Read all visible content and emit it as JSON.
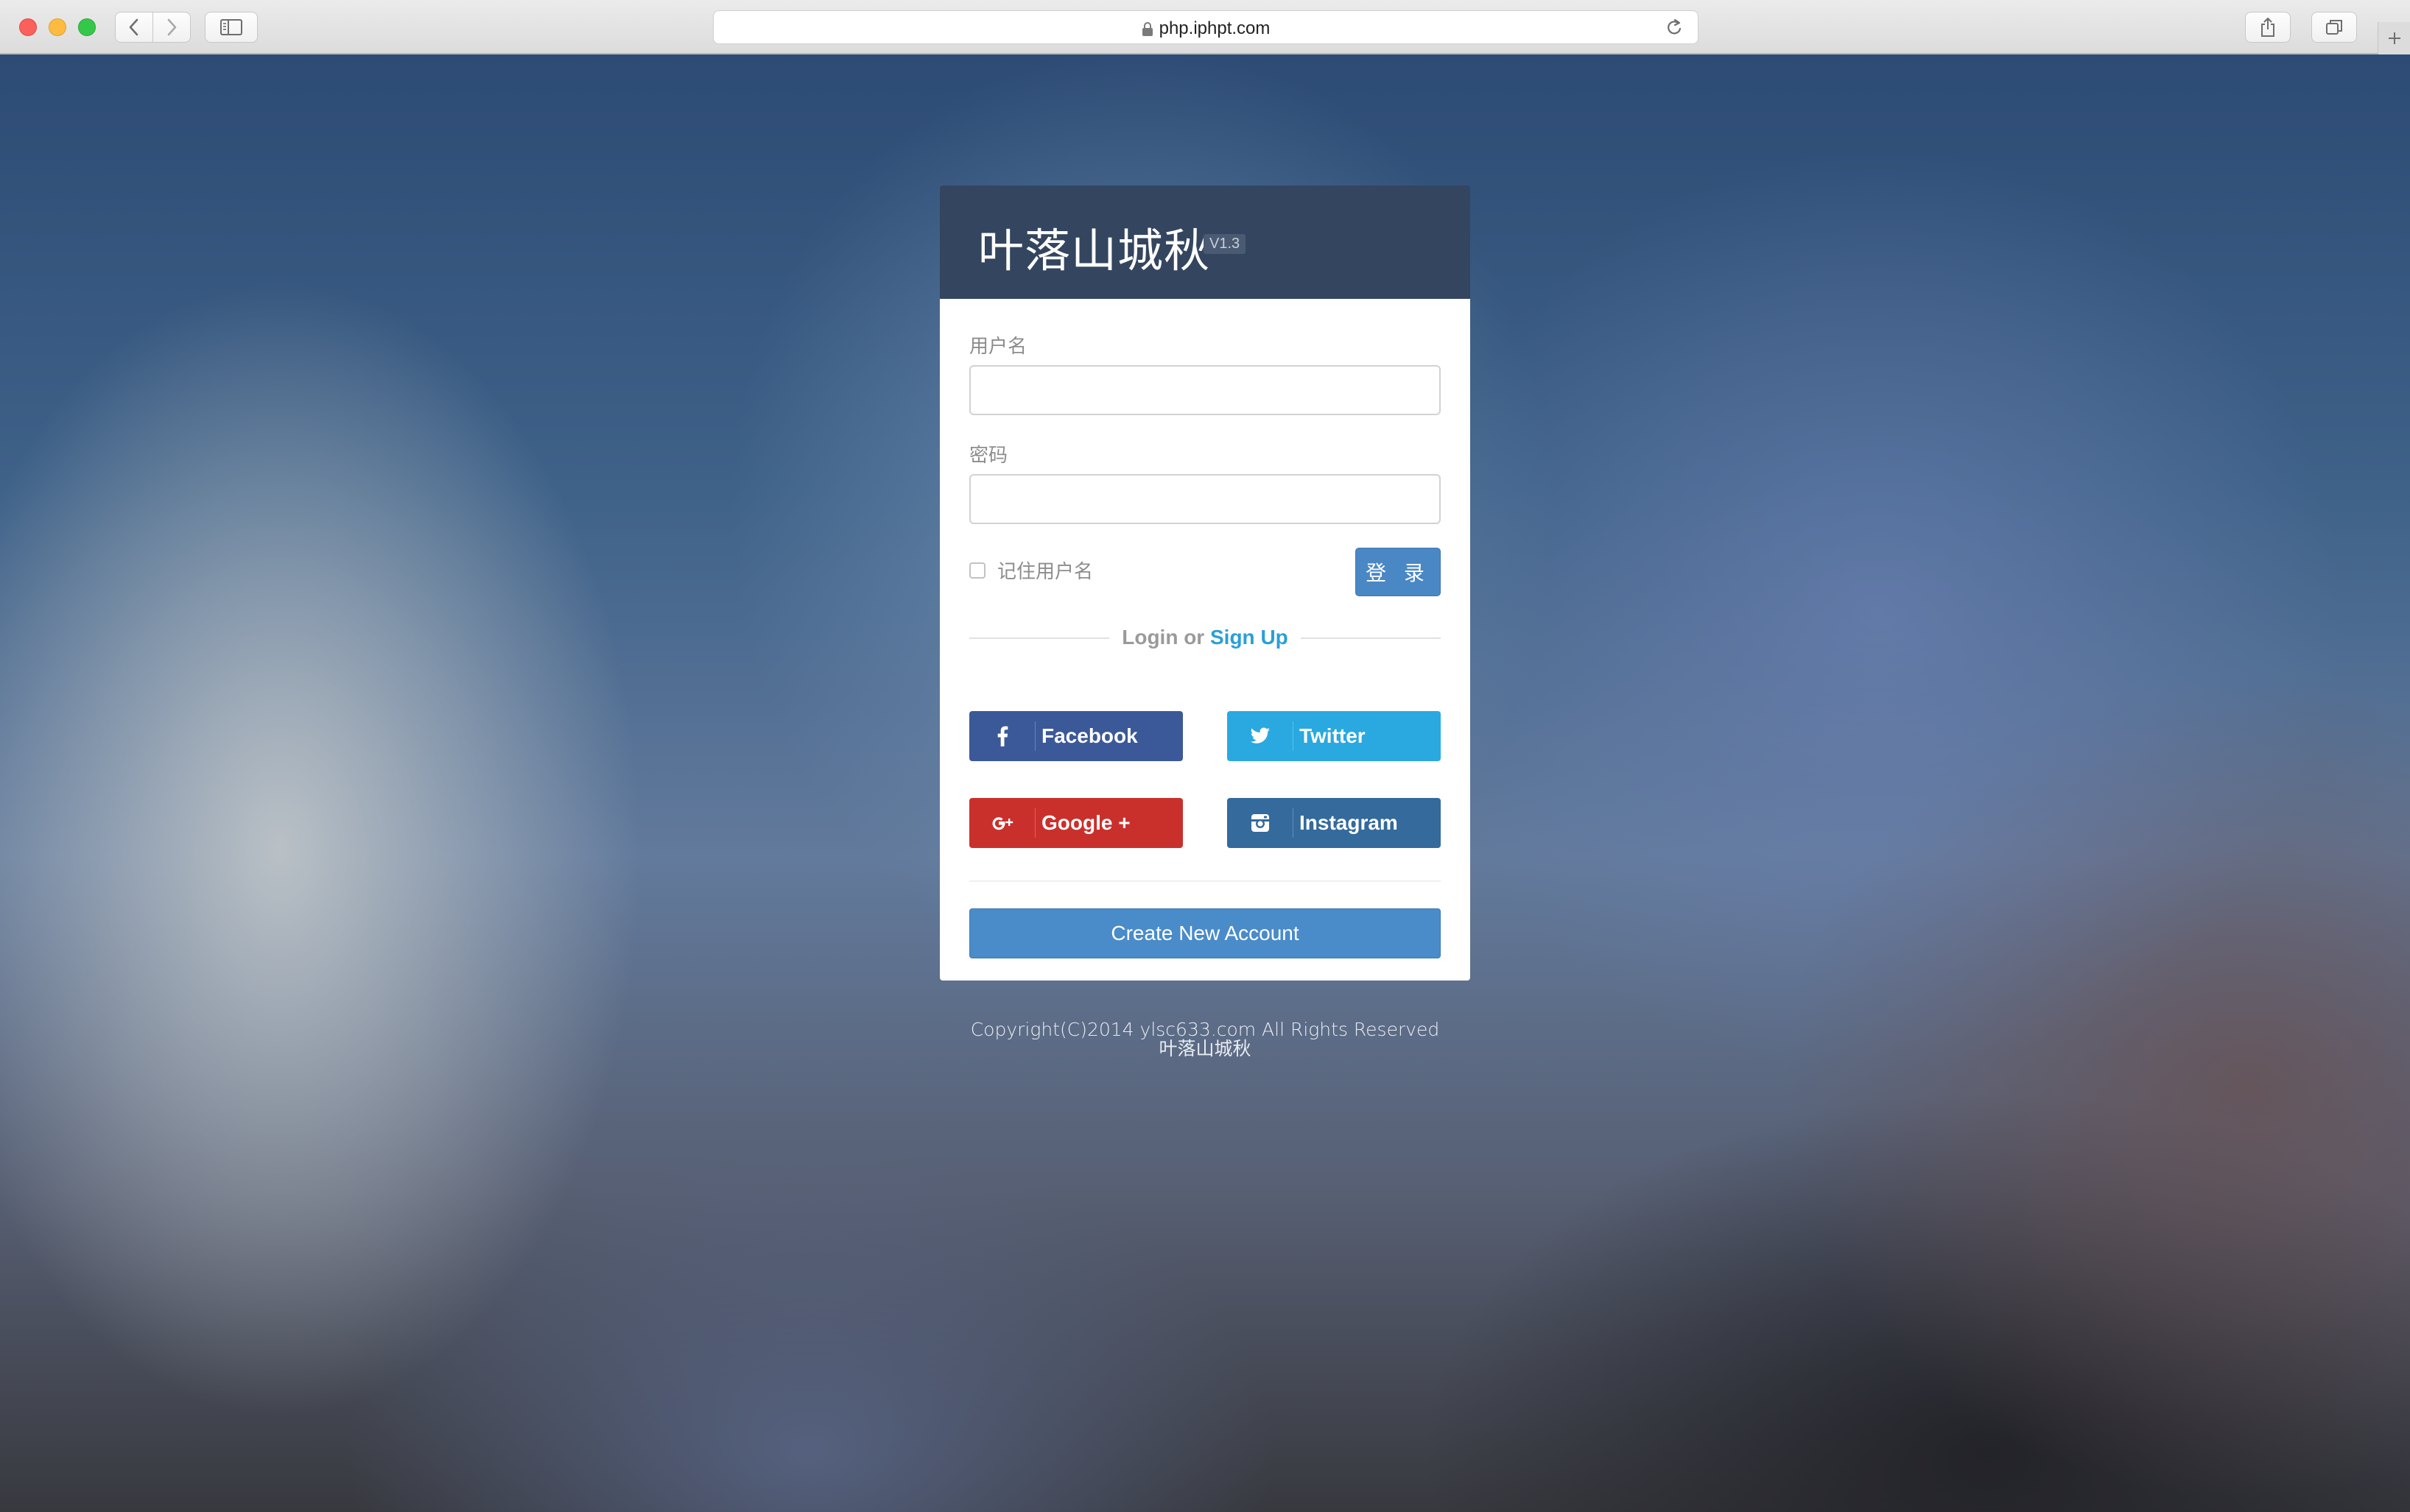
{
  "browser": {
    "url": "php.iphpt.com",
    "icons": {
      "back": "chevron-left-icon",
      "forward": "chevron-right-icon",
      "sidebar": "sidebar-icon",
      "lock": "lock-icon",
      "reload": "reload-icon",
      "share": "share-icon",
      "tabs": "tabs-overview-icon",
      "new_tab": "plus-icon"
    }
  },
  "login": {
    "brand": "叶落山城秋",
    "version": "V1.3",
    "username_label": "用户名",
    "username_value": "",
    "password_label": "密码",
    "password_value": "",
    "remember_label": "记住用户名",
    "remember_checked": false,
    "submit_label": "登 录",
    "divider_prefix": "Login or",
    "divider_link": "Sign Up",
    "social": [
      {
        "label": "Facebook",
        "icon": "facebook-icon",
        "color": "#3b5998"
      },
      {
        "label": "Twitter",
        "icon": "twitter-icon",
        "color": "#2aa8e0"
      },
      {
        "label": "Google +",
        "icon": "google-plus-icon",
        "color": "#c9302c"
      },
      {
        "label": "Instagram",
        "icon": "instagram-icon",
        "color": "#346a9c"
      }
    ],
    "create_account_label": "Create New Account",
    "header_color": "#34455f",
    "accent_color": "#4a87c5",
    "link_color": "#2a9fd8"
  },
  "footer": {
    "copyright": "Copyright(C)2014 ylsc633.com All Rights Reserved",
    "site_name": "叶落山城秋"
  }
}
